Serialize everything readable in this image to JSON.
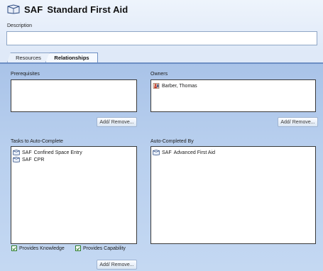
{
  "header": {
    "code": "SAF",
    "title": "Standard First Aid",
    "icon": "training-icon"
  },
  "description": {
    "label": "Description",
    "value": ""
  },
  "tabs": [
    {
      "label": "Resources",
      "active": false
    },
    {
      "label": "Relationships",
      "active": true
    }
  ],
  "prerequisites": {
    "label": "Prerequisites",
    "items": []
  },
  "owners": {
    "label": "Owners",
    "items": [
      {
        "icon": "person-icon",
        "text": "Barber, Thomas"
      }
    ]
  },
  "owners_button": "Add/ Remove...",
  "prereq_button": "Add/ Remove...",
  "tasks": {
    "label": "Tasks to Auto-Complete",
    "items": [
      {
        "icon": "training-icon",
        "code": "SAF",
        "text": "Confined Space Entry"
      },
      {
        "icon": "training-icon",
        "code": "SAF",
        "text": "CPR"
      }
    ]
  },
  "autocompleted": {
    "label": "Auto-Completed By",
    "items": [
      {
        "icon": "training-icon",
        "code": "SAF",
        "text": "Advanced First Aid"
      }
    ]
  },
  "checkboxes": [
    {
      "label": "Provides Knowledge",
      "checked": true
    },
    {
      "label": "Provides Capability",
      "checked": true
    }
  ],
  "tasks_button": "Add/ Remove...",
  "colors": {
    "panel": "#b8cfee",
    "tab_border": "#6d8fc4",
    "check": "#2e7d2e"
  }
}
